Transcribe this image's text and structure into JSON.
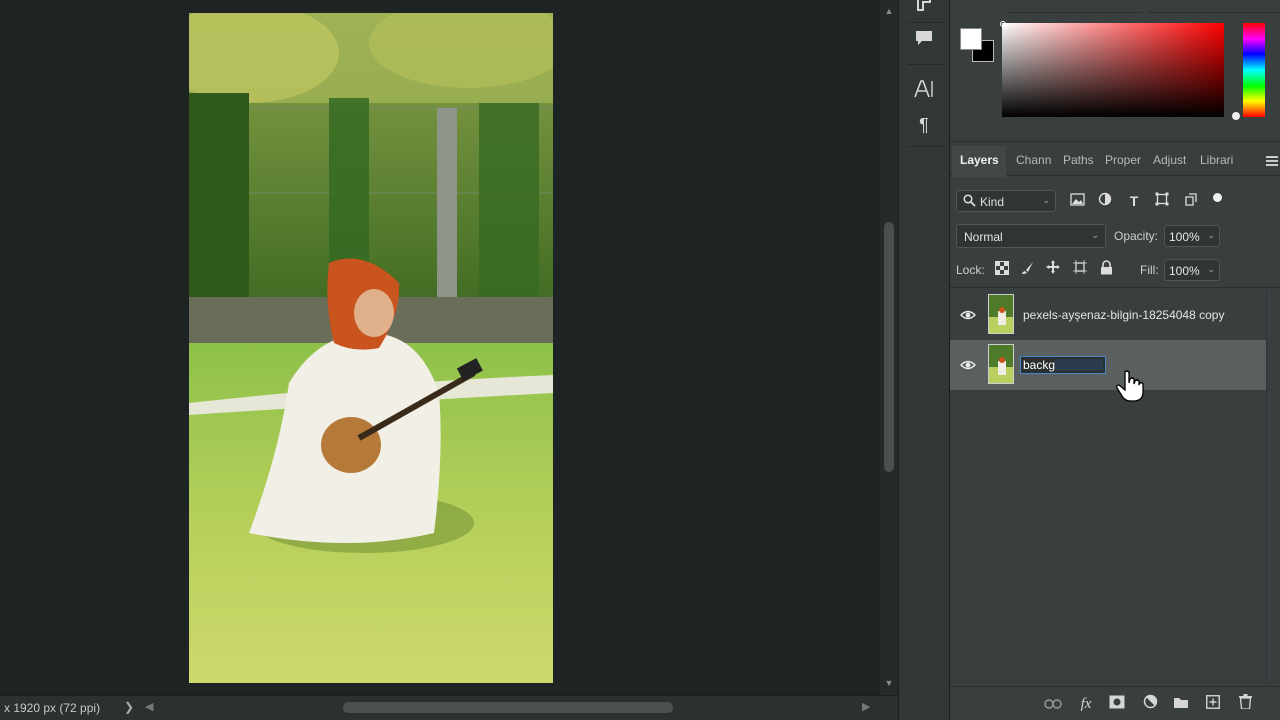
{
  "status_bar": {
    "doc_info": "x 1920 px (72 ppi)",
    "chevron": "❯"
  },
  "colors": {
    "foreground": "#ffffff",
    "background": "#000000",
    "accent": "#4a88c8"
  },
  "toolstrip": {
    "icons": [
      "history-icon",
      "comment-icon",
      "character-icon",
      "paragraph-icon"
    ]
  },
  "layers_panel": {
    "tabs": [
      {
        "label": "Layers",
        "active": true
      },
      {
        "label": "Chann",
        "active": false
      },
      {
        "label": "Paths",
        "active": false
      },
      {
        "label": "Proper",
        "active": false
      },
      {
        "label": "Adjust",
        "active": false
      },
      {
        "label": "Librari",
        "active": false
      }
    ],
    "filter": {
      "kind_label": "Kind"
    },
    "blend_mode": "Normal",
    "opacity_label": "Opacity:",
    "opacity_value": "100%",
    "lock_label": "Lock:",
    "fill_label": "Fill:",
    "fill_value": "100%",
    "layers": [
      {
        "name": "pexels-ayşenaz-bilgin-18254048 copy",
        "visible": true,
        "selected": false
      },
      {
        "name": "backg",
        "visible": true,
        "selected": true,
        "editing": true
      }
    ],
    "rename_text": "backg"
  }
}
